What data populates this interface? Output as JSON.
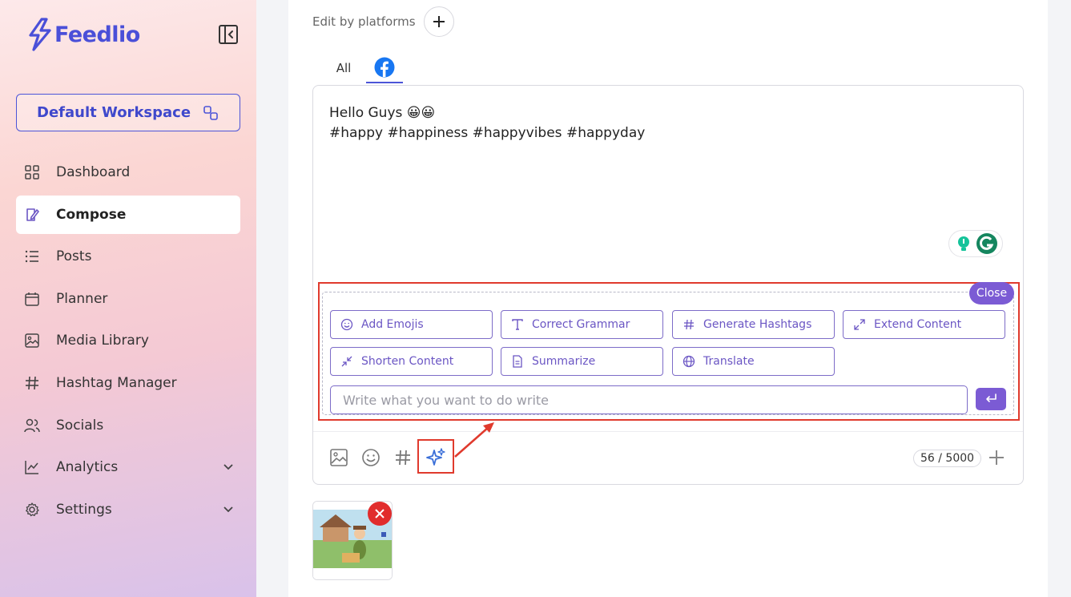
{
  "brand": {
    "name": "Feedlio",
    "color": "#4a4fd8"
  },
  "workspace": {
    "label": "Default Workspace"
  },
  "sidebar": {
    "items": [
      {
        "label": "Dashboard",
        "icon": "dashboard-grid-icon",
        "active": false
      },
      {
        "label": "Compose",
        "icon": "compose-icon",
        "active": true
      },
      {
        "label": "Posts",
        "icon": "list-icon",
        "active": false
      },
      {
        "label": "Planner",
        "icon": "calendar-icon",
        "active": false
      },
      {
        "label": "Media Library",
        "icon": "image-icon",
        "active": false
      },
      {
        "label": "Hashtag Manager",
        "icon": "hashtag-icon",
        "active": false
      },
      {
        "label": "Socials",
        "icon": "users-icon",
        "active": false
      },
      {
        "label": "Analytics",
        "icon": "chart-icon",
        "active": false,
        "expandable": true
      },
      {
        "label": "Settings",
        "icon": "gear-icon",
        "active": false,
        "expandable": true
      }
    ]
  },
  "editor": {
    "edit_by_platforms": "Edit by platforms",
    "tabs": [
      {
        "label": "All"
      },
      {
        "label": "",
        "icon": "facebook-icon",
        "active": true
      }
    ],
    "post_line1": "Hello Guys 😀😀",
    "post_line2": "#happy #happiness #happyvibes #happyday",
    "counter": "56 / 5000"
  },
  "ai_panel": {
    "close_label": "Close",
    "actions": [
      {
        "label": "Add Emojis",
        "icon": "smile-icon"
      },
      {
        "label": "Correct Grammar",
        "icon": "text-t-icon"
      },
      {
        "label": "Generate Hashtags",
        "icon": "hashtag-icon"
      },
      {
        "label": "Extend Content",
        "icon": "expand-icon"
      },
      {
        "label": "Shorten Content",
        "icon": "shrink-icon"
      },
      {
        "label": "Summarize",
        "icon": "document-icon"
      },
      {
        "label": "Translate",
        "icon": "globe-icon"
      }
    ],
    "input_placeholder": "Write what you want to do write",
    "accent": "#7b5bd4"
  }
}
